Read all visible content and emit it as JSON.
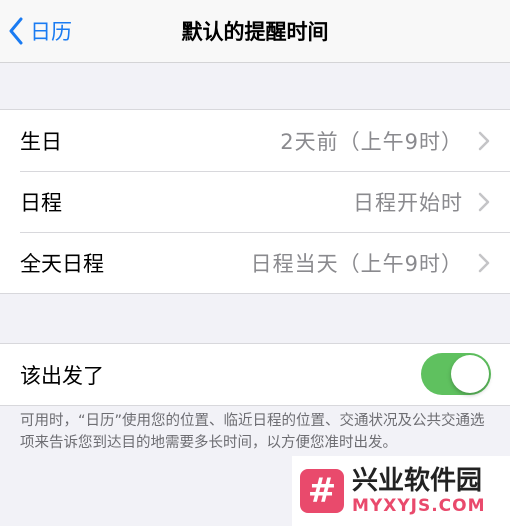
{
  "nav": {
    "back_label": "日历",
    "title": "默认的提醒时间"
  },
  "alerts": {
    "rows": [
      {
        "label": "生日",
        "value": "2天前（上午9时）"
      },
      {
        "label": "日程",
        "value": "日程开始时"
      },
      {
        "label": "全天日程",
        "value": "日程当天（上午9时）"
      }
    ]
  },
  "leave": {
    "label": "该出发了",
    "toggle_on": true,
    "toggle_color": "#5fc15f"
  },
  "footer": {
    "text": "可用时，“日历”使用您的位置、临近日程的位置、交通状况及公共交通选项来告诉您到达目的地需要多长时间，以方便您准时出发。"
  },
  "watermark": {
    "glyph": "#",
    "title": "兴业软件园",
    "subtitle": "MYXYJS.COM"
  },
  "colors": {
    "accent": "#1a7bf2",
    "background": "#f2f2f7",
    "secondary_text": "#8a8a8e"
  }
}
